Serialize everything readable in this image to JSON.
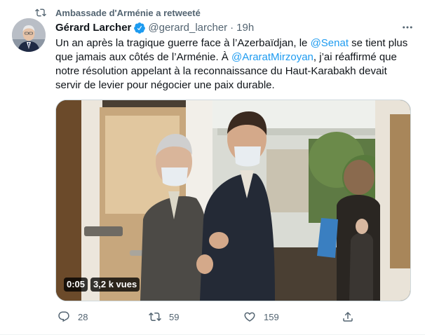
{
  "retweet": {
    "text": "Ambassade d'Arménie a retweeté",
    "icon": "retweet-icon"
  },
  "author": {
    "name": "Gérard Larcher",
    "handle": "@gerard_larcher",
    "separator": "·",
    "time": "19h",
    "verified_icon": "verified-badge-icon",
    "avatar_icon": "avatar"
  },
  "tweet": {
    "part1": "Un an après la tragique guerre face à l’Azerbaïdjan, le ",
    "mention1": "@Senat",
    "part2": " se tient plus que jamais aux côtés de l’Arménie. À ",
    "mention2": "@AraratMirzoyan",
    "part3": ", j’ai réaffirmé que notre résolution appelant à la reconnaissance du Haut-Karabakh devait servir de levier pour négocier une paix durable."
  },
  "video": {
    "duration": "0:05",
    "views": "3,2 k vues"
  },
  "actions": {
    "reply_count": "28",
    "retweet_count": "59",
    "like_count": "159"
  },
  "colors": {
    "accent": "#1d9bf0",
    "secondary_text": "#536471",
    "primary_text": "#0f1419"
  }
}
